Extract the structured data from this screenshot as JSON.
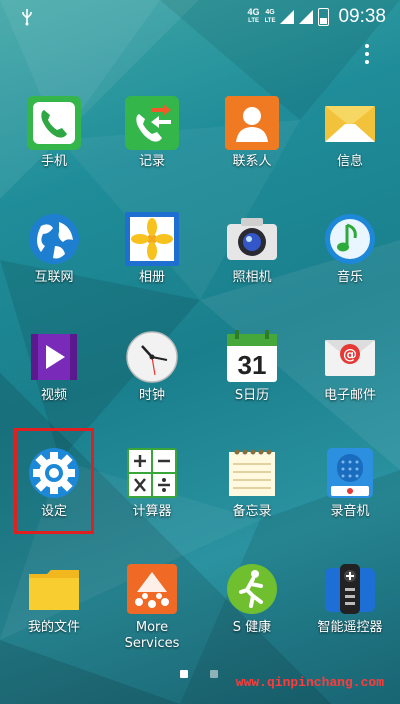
{
  "status": {
    "net_top": "4G",
    "net_top_sub": "LTE",
    "net_second": "4G",
    "net_second_sub": "LTE",
    "time": "09:38"
  },
  "apps": [
    {
      "label": "手机",
      "icon": "phone-icon"
    },
    {
      "label": "记录",
      "icon": "call-log-icon"
    },
    {
      "label": "联系人",
      "icon": "contacts-icon"
    },
    {
      "label": "信息",
      "icon": "messages-icon"
    },
    {
      "label": "互联网",
      "icon": "internet-globe-icon"
    },
    {
      "label": "相册",
      "icon": "gallery-icon"
    },
    {
      "label": "照相机",
      "icon": "camera-icon"
    },
    {
      "label": "音乐",
      "icon": "music-icon"
    },
    {
      "label": "视频",
      "icon": "video-icon"
    },
    {
      "label": "时钟",
      "icon": "clock-icon"
    },
    {
      "label": "S日历",
      "icon": "calendar-icon",
      "calendar_day": "31"
    },
    {
      "label": "电子邮件",
      "icon": "email-icon"
    },
    {
      "label": "设定",
      "icon": "settings-gear-icon"
    },
    {
      "label": "计算器",
      "icon": "calculator-icon"
    },
    {
      "label": "备忘录",
      "icon": "memo-icon"
    },
    {
      "label": "录音机",
      "icon": "voice-recorder-icon"
    },
    {
      "label": "我的文件",
      "icon": "folder-icon"
    },
    {
      "label": "More Services",
      "label_line1": "More",
      "label_line2": "Services",
      "icon": "more-services-icon"
    },
    {
      "label": "S 健康",
      "icon": "s-health-icon"
    },
    {
      "label": "智能遥控器",
      "icon": "smart-remote-icon"
    }
  ],
  "pager": {
    "current": 1,
    "total": 2
  },
  "watermark": "www.qinpinchang.com",
  "colors": {
    "highlight": "#e02020",
    "watermark": "#ff3b3b"
  }
}
